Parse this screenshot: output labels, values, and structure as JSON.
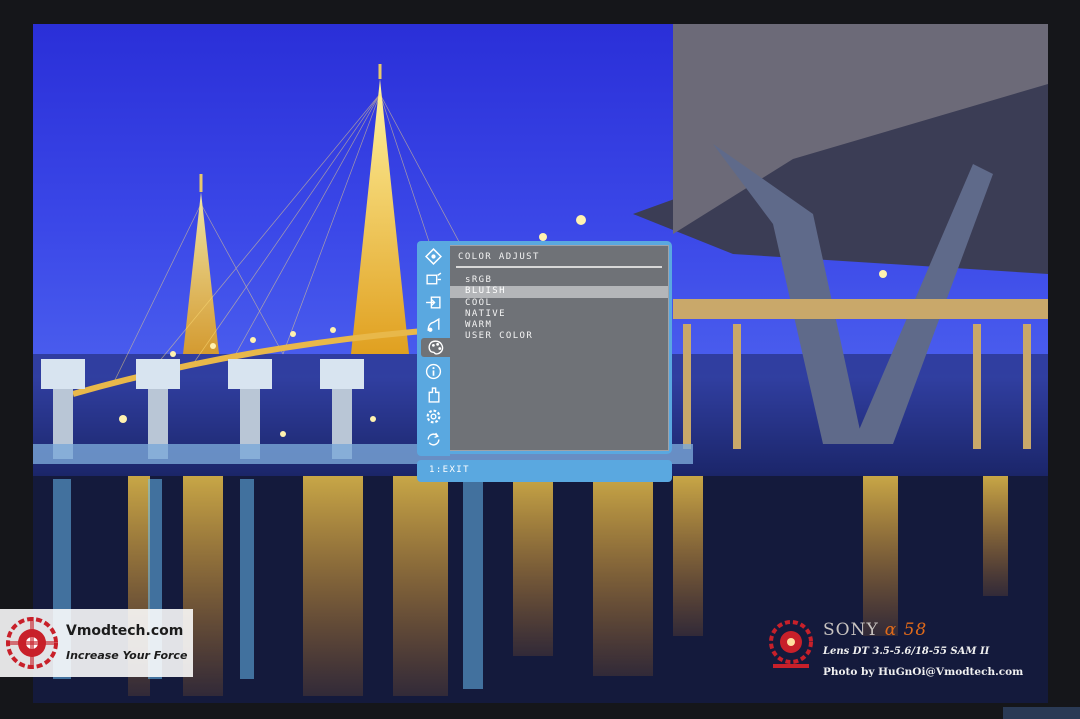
{
  "osd": {
    "title": "COLOR ADJUST",
    "items": [
      {
        "label": "sRGB",
        "selected": false
      },
      {
        "label": "BLUISH",
        "selected": true
      },
      {
        "label": "COOL",
        "selected": false
      },
      {
        "label": "NATIVE",
        "selected": false
      },
      {
        "label": "WARM",
        "selected": false
      },
      {
        "label": "USER COLOR",
        "selected": false
      }
    ],
    "footer": "1:EXIT",
    "sidebar_icons": [
      "auto-adjust-icon",
      "brightness-icon",
      "input-select-icon",
      "audio-icon",
      "color-adjust-icon",
      "information-icon",
      "manual-adjust-icon",
      "setup-menu-icon",
      "memory-recall-icon"
    ],
    "active_icon": "color-adjust-icon",
    "colors": {
      "frame": "#5aa8e0",
      "panel": "#6f7277",
      "highlight": "#b4b6b9"
    }
  },
  "watermark": {
    "site": "Vmodtech.com",
    "tagline": "Increase Your Force",
    "camera_brand": "SONY",
    "camera_model": "α 58",
    "lens": "Lens DT 3.5-5.6/18-55 SAM II",
    "credit": "Photo by HuGnOi@Vmodtech.com"
  }
}
